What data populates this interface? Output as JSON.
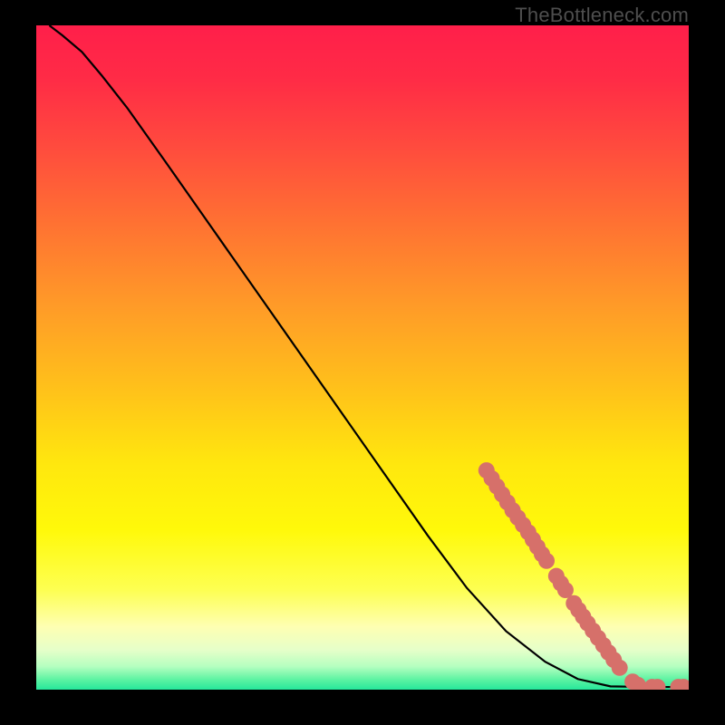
{
  "attribution": "TheBottleneck.com",
  "colors": {
    "marker": "#d6706a",
    "line": "#000000",
    "frame": "#000000"
  },
  "chart_data": {
    "type": "line",
    "title": "",
    "xlabel": "",
    "ylabel": "",
    "xlim": [
      0,
      100
    ],
    "ylim": [
      0,
      100
    ],
    "grid": false,
    "legend": false,
    "gradient_stops": [
      {
        "pos": 0.0,
        "color": "#ff1f4a"
      },
      {
        "pos": 0.08,
        "color": "#ff2b46"
      },
      {
        "pos": 0.18,
        "color": "#ff4a3e"
      },
      {
        "pos": 0.3,
        "color": "#ff7232"
      },
      {
        "pos": 0.42,
        "color": "#ff9a28"
      },
      {
        "pos": 0.55,
        "color": "#ffc21a"
      },
      {
        "pos": 0.66,
        "color": "#ffe70e"
      },
      {
        "pos": 0.76,
        "color": "#fff90a"
      },
      {
        "pos": 0.85,
        "color": "#fdff52"
      },
      {
        "pos": 0.905,
        "color": "#feffb2"
      },
      {
        "pos": 0.94,
        "color": "#e6ffc9"
      },
      {
        "pos": 0.965,
        "color": "#b5ffc0"
      },
      {
        "pos": 0.985,
        "color": "#5cf3a2"
      },
      {
        "pos": 1.0,
        "color": "#26e79b"
      }
    ],
    "curve": [
      {
        "x": 2.0,
        "y": 100.0
      },
      {
        "x": 4.0,
        "y": 98.5
      },
      {
        "x": 7.0,
        "y": 96.0
      },
      {
        "x": 10.0,
        "y": 92.5
      },
      {
        "x": 14.0,
        "y": 87.5
      },
      {
        "x": 20.0,
        "y": 79.2
      },
      {
        "x": 28.0,
        "y": 68.0
      },
      {
        "x": 36.0,
        "y": 56.8
      },
      {
        "x": 44.0,
        "y": 45.6
      },
      {
        "x": 52.0,
        "y": 34.4
      },
      {
        "x": 60.0,
        "y": 23.2
      },
      {
        "x": 66.0,
        "y": 15.3
      },
      {
        "x": 72.0,
        "y": 8.8
      },
      {
        "x": 78.0,
        "y": 4.2
      },
      {
        "x": 83.0,
        "y": 1.6
      },
      {
        "x": 88.0,
        "y": 0.5
      },
      {
        "x": 94.0,
        "y": 0.4
      },
      {
        "x": 100.0,
        "y": 0.4
      }
    ],
    "markers": [
      {
        "x": 69.0,
        "y": 33.0
      },
      {
        "x": 69.8,
        "y": 31.8
      },
      {
        "x": 70.6,
        "y": 30.6
      },
      {
        "x": 71.4,
        "y": 29.4
      },
      {
        "x": 72.2,
        "y": 28.2
      },
      {
        "x": 73.0,
        "y": 27.0
      },
      {
        "x": 73.8,
        "y": 25.9
      },
      {
        "x": 74.6,
        "y": 24.8
      },
      {
        "x": 75.4,
        "y": 23.7
      },
      {
        "x": 76.1,
        "y": 22.6
      },
      {
        "x": 76.8,
        "y": 21.5
      },
      {
        "x": 77.5,
        "y": 20.4
      },
      {
        "x": 78.2,
        "y": 19.4
      },
      {
        "x": 79.7,
        "y": 17.1
      },
      {
        "x": 80.4,
        "y": 16.0
      },
      {
        "x": 81.1,
        "y": 15.0
      },
      {
        "x": 82.4,
        "y": 13.0
      },
      {
        "x": 83.1,
        "y": 12.0
      },
      {
        "x": 83.8,
        "y": 11.0
      },
      {
        "x": 84.5,
        "y": 10.0
      },
      {
        "x": 85.3,
        "y": 8.9
      },
      {
        "x": 86.1,
        "y": 7.8
      },
      {
        "x": 86.9,
        "y": 6.7
      },
      {
        "x": 87.7,
        "y": 5.6
      },
      {
        "x": 88.5,
        "y": 4.5
      },
      {
        "x": 89.4,
        "y": 3.3
      },
      {
        "x": 91.4,
        "y": 1.2
      },
      {
        "x": 92.2,
        "y": 0.7
      },
      {
        "x": 94.4,
        "y": 0.4
      },
      {
        "x": 95.2,
        "y": 0.4
      },
      {
        "x": 98.4,
        "y": 0.4
      },
      {
        "x": 99.2,
        "y": 0.4
      }
    ]
  }
}
